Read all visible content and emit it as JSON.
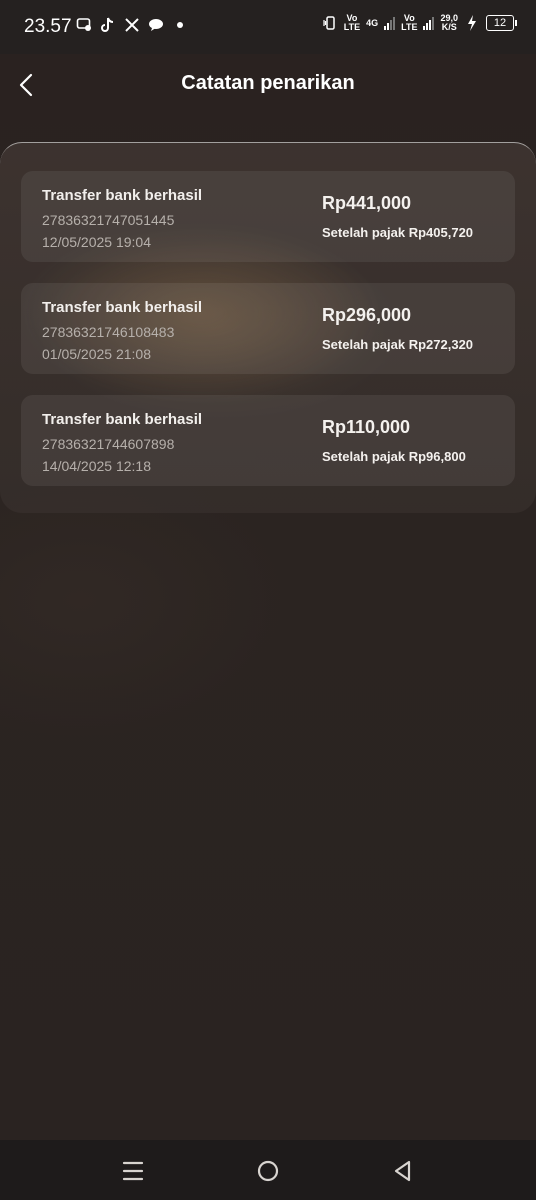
{
  "status_bar": {
    "time": "23.57",
    "signal1": {
      "line1": "Vo",
      "line2": "LTE"
    },
    "network": "4G",
    "signal2": {
      "line1": "Vo",
      "line2": "LTE"
    },
    "speed": {
      "value": "29,0",
      "unit": "K/S"
    },
    "battery": "12"
  },
  "header": {
    "title": "Catatan penarikan"
  },
  "withdrawals": [
    {
      "status": "Transfer bank berhasil",
      "id": "27836321747051445",
      "datetime": "12/05/2025 19:04",
      "amount": "Rp441,000",
      "after_tax": "Setelah pajak Rp405,720"
    },
    {
      "status": "Transfer bank berhasil",
      "id": "27836321746108483",
      "datetime": "01/05/2025 21:08",
      "amount": "Rp296,000",
      "after_tax": "Setelah pajak Rp272,320"
    },
    {
      "status": "Transfer bank berhasil",
      "id": "27836321744607898",
      "datetime": "14/04/2025 12:18",
      "amount": "Rp110,000",
      "after_tax": "Setelah pajak Rp96,800"
    }
  ],
  "icons": {
    "back": "chevron-left-icon",
    "nav_menu": "menu-icon",
    "nav_home": "home-circle-icon",
    "nav_back": "back-triangle-icon"
  }
}
